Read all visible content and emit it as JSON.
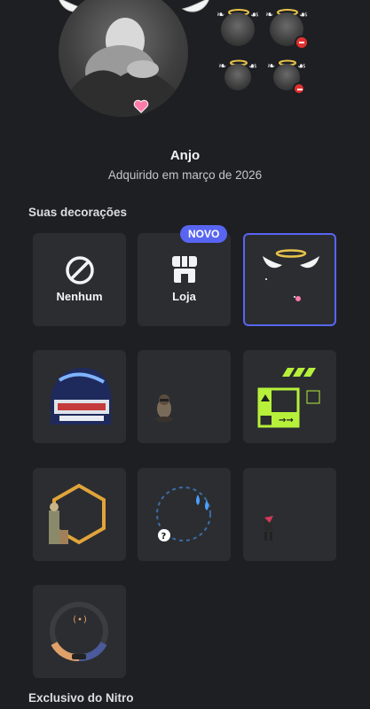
{
  "decoration": {
    "name": "Anjo",
    "acquired": "Adquirido em março de 2026"
  },
  "sections": {
    "your_decorations": "Suas decorações",
    "nitro_exclusive": "Exclusivo do Nitro"
  },
  "tiles": {
    "none_label": "Nenhum",
    "shop_label": "Loja",
    "new_badge": "NOVO"
  },
  "colors": {
    "background": "#1e1f23",
    "tile": "#2b2d31",
    "accent": "#5865f2",
    "danger": "#e0312f",
    "lime": "#b6f03a"
  },
  "icons": {
    "none": "prohibited-icon",
    "shop": "shop-icon"
  }
}
